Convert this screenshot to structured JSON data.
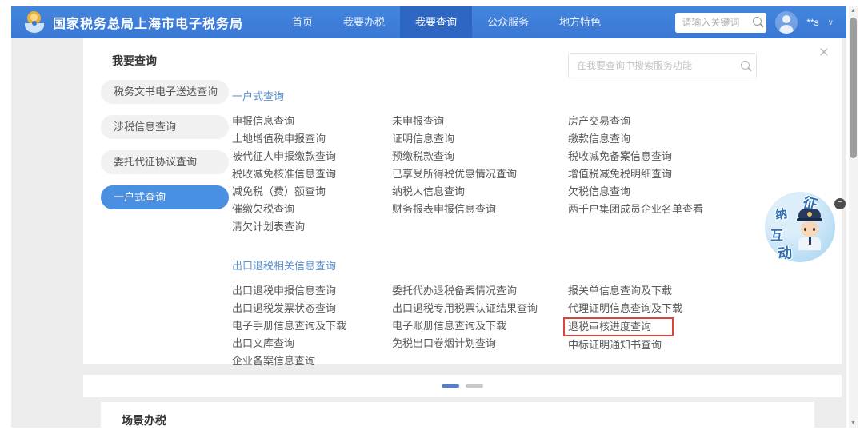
{
  "header": {
    "brand": "国家税务总局上海市电子税务局",
    "nav": [
      {
        "label": "首页",
        "active": false
      },
      {
        "label": "我要办税",
        "active": false
      },
      {
        "label": "我要查询",
        "active": true
      },
      {
        "label": "公众服务",
        "active": false
      },
      {
        "label": "地方特色",
        "active": false
      }
    ],
    "search_placeholder": "请输入关键词",
    "username": "**s"
  },
  "sidebar": {
    "title": "我要查询",
    "items": [
      {
        "label": "税务文书电子送达查询",
        "active": false
      },
      {
        "label": "涉税信息查询",
        "active": false
      },
      {
        "label": "委托代征协议查询",
        "active": false
      },
      {
        "label": "一户式查询",
        "active": true
      }
    ]
  },
  "panel": {
    "search_placeholder": "在我要查询中搜索服务功能",
    "sections": [
      {
        "title": "一户式查询",
        "columns": [
          [
            "申报信息查询",
            "土地增值税申报查询",
            "被代征人申报缴款查询",
            "税收减免核准信息查询",
            "减免税（费）额查询",
            "催缴欠税查询",
            "清欠计划表查询"
          ],
          [
            "未申报查询",
            "证明信息查询",
            "预缴税款查询",
            "已享受所得税优惠情况查询",
            "纳税人信息查询",
            "财务报表申报信息查询"
          ],
          [
            "房产交易查询",
            "缴款信息查询",
            "税收减免备案信息查询",
            "增值税减免税明细查询",
            "欠税信息查询",
            "两千户集团成员企业名单查看"
          ]
        ]
      },
      {
        "title": "出口退税相关信息查询",
        "columns": [
          [
            "出口退税申报信息查询",
            "出口退税发票状态查询",
            "电子手册信息查询及下载",
            "出口文库查询",
            "企业备案信息查询"
          ],
          [
            "委托代办退税备案情况查询",
            "出口退税专用税票认证结果查询",
            "电子账册信息查询及下载",
            "免税出口卷烟计划查询"
          ],
          [
            "报关单信息查询及下载",
            "代理证明信息查询及下载",
            "退税审核进度查询",
            "中标证明通知书查询"
          ]
        ],
        "highlighted_item": "退税审核进度查询"
      }
    ]
  },
  "carousel": {
    "page_count": 2,
    "active_page": 1
  },
  "bottom": {
    "next_section_title": "场景办税"
  },
  "mascot": {
    "chars": [
      "征",
      "纳",
      "互",
      "动"
    ]
  },
  "icons": {
    "close": "×",
    "chevron_down": "∨",
    "minimize": "−",
    "scroll_up": "▲",
    "scroll_down": "▼"
  },
  "colors": {
    "header_blue": "#3c7ad6",
    "nav_active_blue": "#2d67c3",
    "sidebar_active_blue": "#4a90e2",
    "section_title_blue": "#5b92cf",
    "highlight_red": "#d9453c",
    "carousel_active_blue": "#4e81d6"
  }
}
